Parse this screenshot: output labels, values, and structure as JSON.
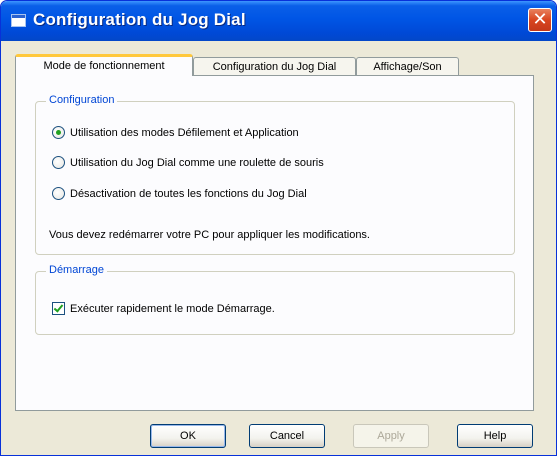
{
  "window": {
    "title": "Configuration du Jog Dial",
    "close_glyph": "✕"
  },
  "tabs": [
    {
      "label": "Mode de fonctionnement",
      "active": true
    },
    {
      "label": "Configuration du Jog Dial",
      "active": false
    },
    {
      "label": "Affichage/Son",
      "active": false
    }
  ],
  "configuration_group": {
    "title": "Configuration",
    "options": [
      {
        "label": "Utilisation des modes Défilement et Application",
        "selected": true
      },
      {
        "label": "Utilisation du Jog Dial comme une roulette de souris",
        "selected": false
      },
      {
        "label": "Désactivation de toutes les fonctions du Jog Dial",
        "selected": false
      }
    ],
    "restart_note": "Vous devez redémarrer votre PC pour appliquer les modifications."
  },
  "startup_group": {
    "title": "Démarrage",
    "checkbox_label": "Exécuter rapidement le mode Démarrage.",
    "checked": true
  },
  "buttons": {
    "ok": "OK",
    "cancel": "Cancel",
    "apply": "Apply",
    "help": "Help"
  },
  "icons": {
    "window_icon": "jog-dial-window-icon",
    "close": "close-icon"
  },
  "colors": {
    "titlebar": "#0055e5",
    "group_title": "#0046d5",
    "active_tab_highlight": "#ffc83c",
    "close_button": "#d9451f"
  }
}
